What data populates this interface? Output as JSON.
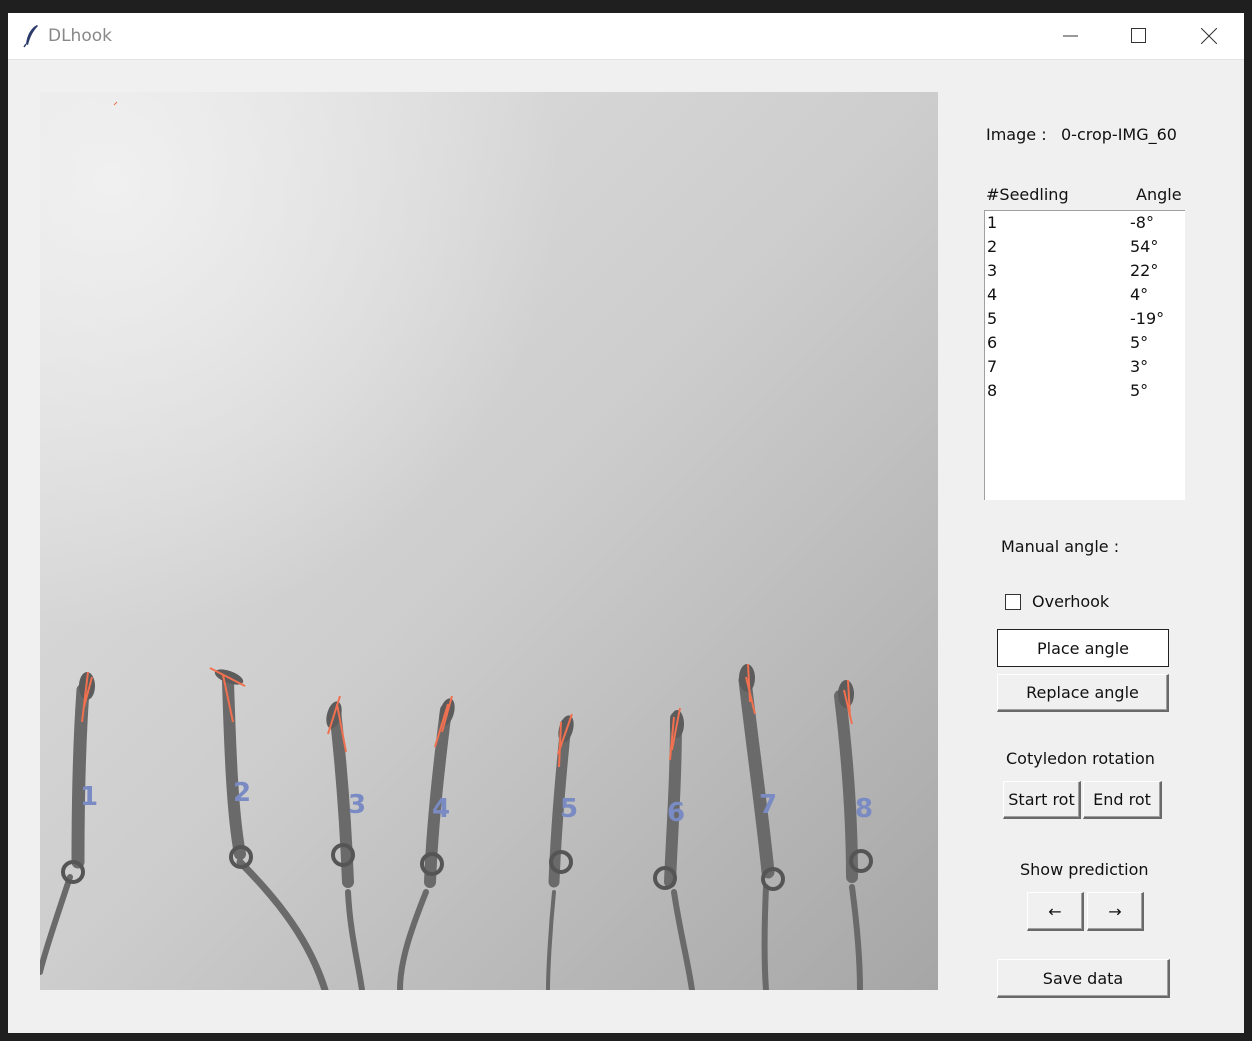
{
  "window": {
    "title": "DLhook",
    "icon": "feather-icon"
  },
  "image": {
    "label": "Image :",
    "filename": "0-crop-IMG_60",
    "seedling_numbers": [
      "1",
      "2",
      "3",
      "4",
      "5",
      "6",
      "7",
      "8"
    ]
  },
  "seedlings": {
    "header_seedling": "#Seedling",
    "header_angle": "Angle",
    "rows": [
      {
        "id": "1",
        "angle": "-8°"
      },
      {
        "id": "2",
        "angle": "54°"
      },
      {
        "id": "3",
        "angle": "22°"
      },
      {
        "id": "4",
        "angle": "4°"
      },
      {
        "id": "5",
        "angle": "-19°"
      },
      {
        "id": "6",
        "angle": "5°"
      },
      {
        "id": "7",
        "angle": "3°"
      },
      {
        "id": "8",
        "angle": "5°"
      }
    ]
  },
  "manual": {
    "label": "Manual angle :",
    "overhook_label": "Overhook",
    "overhook_checked": false,
    "place_label": "Place angle",
    "replace_label": "Replace angle"
  },
  "cotyledon": {
    "label": "Cotyledon rotation",
    "start_label": "Start rot",
    "end_label": "End rot"
  },
  "prediction": {
    "label": "Show prediction",
    "prev_label": "←",
    "next_label": "→"
  },
  "save_label": "Save data",
  "colors": {
    "window_bg": "#f0f0f0",
    "annotation_line": "#f07050",
    "number_label": "#7a8bc4"
  }
}
